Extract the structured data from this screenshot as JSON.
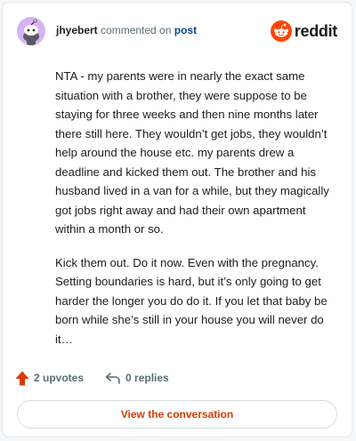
{
  "header": {
    "username": "jhyebert",
    "action_text": "commented on",
    "target_link": "post",
    "logo_text": "reddit"
  },
  "comment": {
    "paragraphs": [
      "NTA - my parents were in nearly the exact same situation with a brother, they were suppose to be staying for three weeks and then nine months later there still here. They wouldn’t get jobs, they wouldn’t help around the house etc. my parents drew a deadline and kicked them out. The brother and his husband lived in a van for a while, but they magically got jobs right away and had their own apartment within a month or so.",
      "Kick them out. Do it now. Even with the pregnancy. Setting boundaries is hard, but it’s only going to get harder the longer you do do it. If you let that baby be born while she’s still in your house you will never do it…"
    ]
  },
  "actions": {
    "upvotes_label": "2 upvotes",
    "replies_label": "0 replies"
  },
  "footer": {
    "view_button_label": "View the conversation"
  },
  "icons": {
    "avatar": "snoo-avatar-icon",
    "logo": "reddit-logo-icon",
    "upvote": "upvote-arrow-icon",
    "reply": "reply-arrow-icon"
  },
  "colors": {
    "accent": "#d93a00",
    "logo_orange": "#ff4500",
    "link_blue": "#0a449b",
    "muted": "#576f76",
    "avatar_bg": "#d6b3f2"
  }
}
